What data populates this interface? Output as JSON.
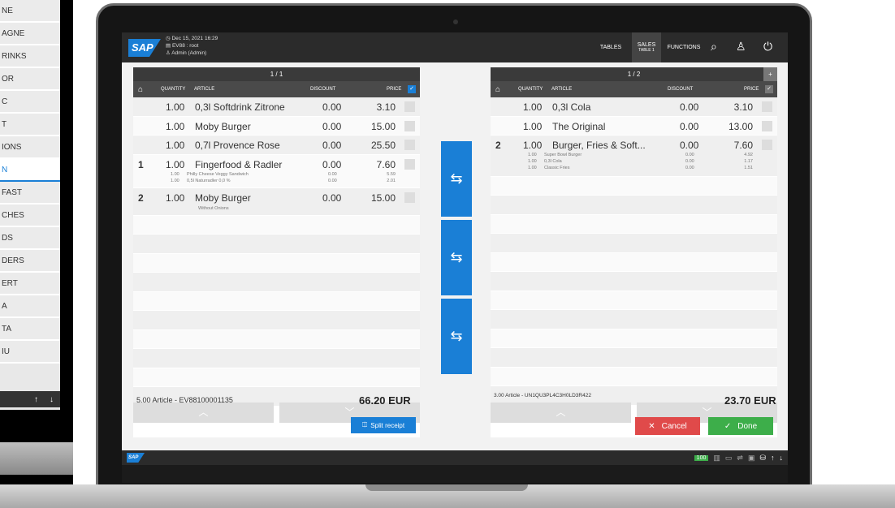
{
  "left_device": {
    "items": [
      "NE",
      "AGNE",
      "RINKS",
      "OR",
      "C",
      "T",
      "IONS",
      "N",
      "FAST",
      "CHES",
      "DS",
      "DERS",
      "ERT",
      "A",
      "TA",
      "IU"
    ],
    "active_index": 7,
    "bottom_arrows": [
      "↑",
      "↓"
    ]
  },
  "header": {
    "logo": "SAP",
    "datetime": "Dec 15, 2021 16:29",
    "terminal": "EV88 : root",
    "user": "Admin (Admin)",
    "nav_tables": "TABLES",
    "nav_sales": "SALES",
    "nav_sales_sub": "TABLE 1",
    "nav_functions": "FUNCTIONS",
    "icons": [
      "search-icon",
      "user-icon",
      "power-icon"
    ]
  },
  "left_panel": {
    "page": "1 / 1",
    "columns": {
      "quantity": "QUANTITY",
      "article": "ARTICLE",
      "discount": "DISCOUNT",
      "price": "PRICE"
    },
    "rows": [
      {
        "seat": "",
        "qty": "1.00",
        "article": "0,3l Softdrink Zitrone",
        "discount": "0.00",
        "price": "3.10",
        "subs": []
      },
      {
        "seat": "",
        "qty": "1.00",
        "article": "Moby Burger",
        "discount": "0.00",
        "price": "15.00",
        "subs": []
      },
      {
        "seat": "",
        "qty": "1.00",
        "article": "0,7l Provence Rose",
        "discount": "0.00",
        "price": "25.50",
        "subs": []
      },
      {
        "seat": "1",
        "qty": "1.00",
        "article": "Fingerfood & Radler",
        "discount": "0.00",
        "price": "7.60",
        "subs": [
          {
            "qty": "1.00",
            "article": "Philly Cheese Veggy Sandwich",
            "discount": "0.00",
            "price": "5.59"
          },
          {
            "qty": "1.00",
            "article": "0,5l Naturradler 0,0 %",
            "discount": "0.00",
            "price": "2.01"
          }
        ]
      },
      {
        "seat": "2",
        "qty": "1.00",
        "article": "Moby Burger",
        "discount": "0.00",
        "price": "15.00",
        "note": "Without Onions",
        "subs": []
      }
    ],
    "summary": "5.00 Article - EV88100001135",
    "total": "66.20 EUR",
    "split_label": "Split receipt"
  },
  "right_panel": {
    "page": "1 / 2",
    "add": "+",
    "columns": {
      "quantity": "QUANTITY",
      "article": "ARTICLE",
      "discount": "DISCOUNT",
      "price": "PRICE"
    },
    "rows": [
      {
        "seat": "",
        "qty": "1.00",
        "article": "0,3l Cola",
        "discount": "0.00",
        "price": "3.10",
        "subs": []
      },
      {
        "seat": "",
        "qty": "1.00",
        "article": "The Original",
        "discount": "0.00",
        "price": "13.00",
        "subs": []
      },
      {
        "seat": "2",
        "qty": "1.00",
        "article": "Burger, Fries & Soft...",
        "discount": "0.00",
        "price": "7.60",
        "subs": [
          {
            "qty": "1.00",
            "article": "Super Bowl Burger",
            "discount": "0.00",
            "price": "4.92"
          },
          {
            "qty": "1.00",
            "article": "0,3l Cola",
            "discount": "0.00",
            "price": "1.17"
          },
          {
            "qty": "1.00",
            "article": "Classic Fries",
            "discount": "0.00",
            "price": "1.51"
          }
        ]
      }
    ],
    "summary": "3.00 Article - UN1QU3PL4C3H0LD3R422",
    "total": "23.70 EUR",
    "cancel": "Cancel",
    "done": "Done"
  },
  "status_bar": {
    "logo": "SAP",
    "badge": "100"
  },
  "colors": {
    "accent": "#1a7fd6",
    "header": "#2b2b2b",
    "cancel": "#e04a4a",
    "done": "#3dae4a"
  }
}
